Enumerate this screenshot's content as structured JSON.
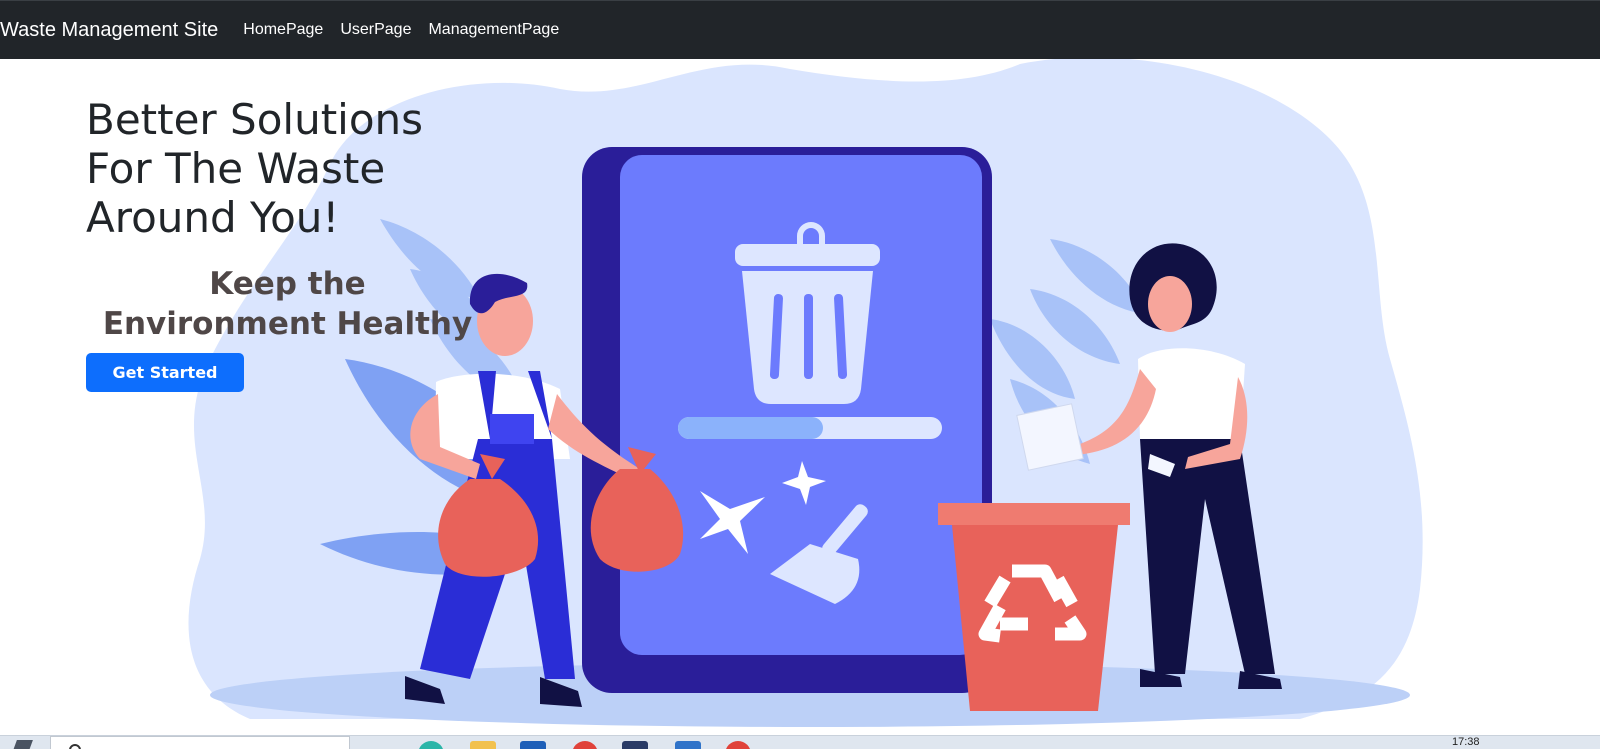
{
  "navbar": {
    "brand": "Waste Management Site",
    "links": [
      "HomePage",
      "UserPage",
      "ManagementPage"
    ]
  },
  "hero": {
    "title": "Better Solutions For The Waste Around You!",
    "subtitle": "Keep the Environment Healthy",
    "cta_label": "Get Started",
    "progress": 0.55
  },
  "taskbar": {
    "clock": "17:38"
  },
  "colors": {
    "navbar_bg": "#212529",
    "primary": "#0d6efd",
    "subtitle": "#4f4747",
    "phone_screen": "#6c7bfd",
    "phone_frame": "#2a1e99",
    "bin": "#e8625a",
    "blob": "#dae5fe"
  }
}
